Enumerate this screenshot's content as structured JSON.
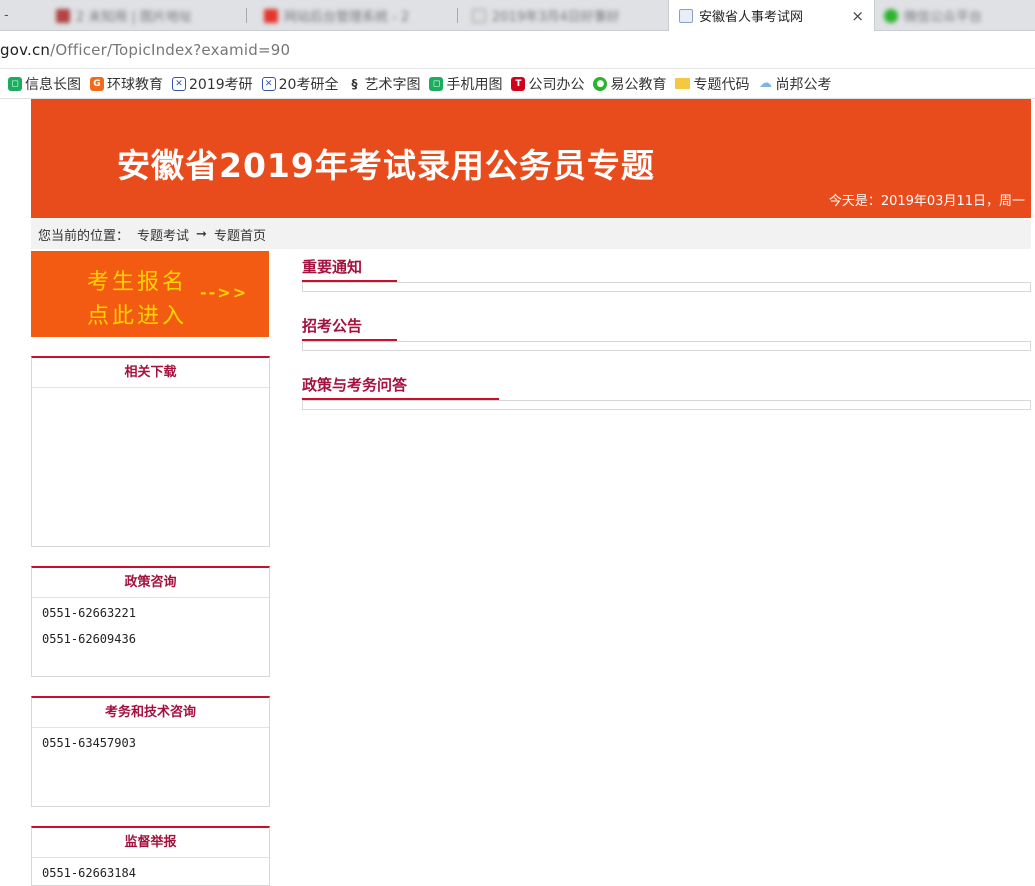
{
  "browser": {
    "tabs": [
      {
        "label": "2 未知用 | 图片地址"
      },
      {
        "label": "网站后台管理系统 - 2"
      },
      {
        "label": "2019年3月4日好事好"
      },
      {
        "label": "安徽省人事考试网",
        "active": true
      },
      {
        "label": "微信公众平台"
      }
    ],
    "tab_left_stub": "-",
    "close_glyph": "×",
    "url_host": "gov.cn",
    "url_path": "/Officer/TopicIndex?examid=90"
  },
  "bookmarks": [
    {
      "label": "信息长图",
      "icon": "green-square-icon",
      "color": "#1aad5e"
    },
    {
      "label": "环球教育",
      "icon": "orange-g-icon",
      "color": "#f26b1d"
    },
    {
      "label": "2019考研",
      "icon": "blue-cross-icon",
      "color": "#3358a8"
    },
    {
      "label": "20考研全",
      "icon": "blue-cross-icon",
      "color": "#3358a8"
    },
    {
      "label": "艺术字图",
      "icon": "dark-s-icon",
      "color": "#333333"
    },
    {
      "label": "手机用图",
      "icon": "green-square-icon",
      "color": "#1aad5e"
    },
    {
      "label": "公司办公",
      "icon": "red-t-icon",
      "color": "#d0021b"
    },
    {
      "label": "易公教育",
      "icon": "wechat-icon",
      "color": "#2bb32b"
    },
    {
      "label": "专题代码",
      "icon": "folder-icon",
      "color": "#f5c842"
    },
    {
      "label": "尚邦公考",
      "icon": "cloud-icon",
      "color": "#7fb2e5"
    }
  ],
  "page": {
    "banner_title": "安徽省2019年考试录用公务员专题",
    "banner_date": "今天是：2019年03月11日，周一",
    "breadcrumb": {
      "prefix": "您当前的位置：",
      "item1": "专题考试",
      "arrow": "➞",
      "item2": "专题首页"
    },
    "register": {
      "line1": "考生报名",
      "line2": "点此进入",
      "arrow": "-->>"
    },
    "boxes": [
      {
        "title": "相关下载",
        "lines": []
      },
      {
        "title": "政策咨询",
        "lines": [
          "0551-62663221",
          "0551-62609436"
        ]
      },
      {
        "title": "考务和技术咨询",
        "lines": [
          "0551-63457903"
        ]
      },
      {
        "title": "监督举报",
        "lines": [
          "0551-62663184"
        ]
      }
    ],
    "sections": [
      {
        "title": "重要通知"
      },
      {
        "title": "招考公告"
      },
      {
        "title": "政策与考务问答"
      }
    ]
  },
  "colors": {
    "banner": "#e94c1c",
    "register": "#f35a12",
    "register_text": "#ffd400",
    "accent_red": "#c8102e",
    "heading": "#a4123f"
  }
}
